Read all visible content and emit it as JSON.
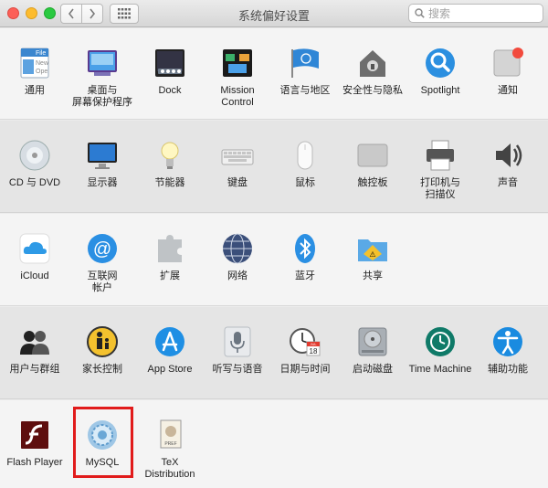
{
  "window": {
    "title": "系统偏好设置"
  },
  "search": {
    "placeholder": "搜索"
  },
  "rows": [
    [
      {
        "name": "pane-general",
        "icon": "general-icon",
        "label": "通用"
      },
      {
        "name": "pane-desktop",
        "icon": "desktop-screensaver-icon",
        "label": "桌面与\n屏幕保护程序"
      },
      {
        "name": "pane-dock",
        "icon": "dock-icon",
        "label": "Dock"
      },
      {
        "name": "pane-mission-control",
        "icon": "mission-control-icon",
        "label": "Mission\nControl"
      },
      {
        "name": "pane-language-region",
        "icon": "flag-icon",
        "label": "语言与地区"
      },
      {
        "name": "pane-security",
        "icon": "house-lock-icon",
        "label": "安全性与隐私"
      },
      {
        "name": "pane-spotlight",
        "icon": "spotlight-icon",
        "label": "Spotlight"
      },
      {
        "name": "pane-notifications",
        "icon": "notification-icon",
        "label": "通知"
      }
    ],
    [
      {
        "name": "pane-cd-dvd",
        "icon": "disc-icon",
        "label": "CD 与 DVD"
      },
      {
        "name": "pane-displays",
        "icon": "display-icon",
        "label": "显示器"
      },
      {
        "name": "pane-energy",
        "icon": "lightbulb-icon",
        "label": "节能器"
      },
      {
        "name": "pane-keyboard",
        "icon": "keyboard-icon",
        "label": "键盘"
      },
      {
        "name": "pane-mouse",
        "icon": "mouse-icon",
        "label": "鼠标"
      },
      {
        "name": "pane-trackpad",
        "icon": "trackpad-icon",
        "label": "触控板"
      },
      {
        "name": "pane-printers",
        "icon": "printer-icon",
        "label": "打印机与\n扫描仪"
      },
      {
        "name": "pane-sound",
        "icon": "speaker-icon",
        "label": "声音"
      }
    ],
    [
      {
        "name": "pane-icloud",
        "icon": "icloud-icon",
        "label": "iCloud"
      },
      {
        "name": "pane-internet-accounts",
        "icon": "at-icon",
        "label": "互联网\n帐户"
      },
      {
        "name": "pane-extensions",
        "icon": "puzzle-icon",
        "label": "扩展"
      },
      {
        "name": "pane-network",
        "icon": "globe-icon",
        "label": "网络"
      },
      {
        "name": "pane-bluetooth",
        "icon": "bluetooth-icon",
        "label": "蓝牙"
      },
      {
        "name": "pane-sharing",
        "icon": "sharing-folder-icon",
        "label": "共享"
      }
    ],
    [
      {
        "name": "pane-users-groups",
        "icon": "users-icon",
        "label": "用户与群组"
      },
      {
        "name": "pane-parental-controls",
        "icon": "parental-icon",
        "label": "家长控制"
      },
      {
        "name": "pane-app-store",
        "icon": "app-store-icon",
        "label": "App Store"
      },
      {
        "name": "pane-dictation-speech",
        "icon": "microphone-icon",
        "label": "听写与语音"
      },
      {
        "name": "pane-date-time",
        "icon": "clock-calendar-icon",
        "label": "日期与时间"
      },
      {
        "name": "pane-startup-disk",
        "icon": "hard-disk-icon",
        "label": "启动磁盘"
      },
      {
        "name": "pane-time-machine",
        "icon": "time-machine-icon",
        "label": "Time Machine"
      },
      {
        "name": "pane-accessibility",
        "icon": "accessibility-icon",
        "label": "辅助功能"
      }
    ],
    [
      {
        "name": "pane-flash-player",
        "icon": "flash-icon",
        "label": "Flash Player"
      },
      {
        "name": "pane-mysql",
        "icon": "mysql-icon",
        "label": "MySQL"
      },
      {
        "name": "pane-tex-distribution",
        "icon": "tex-icon",
        "label": "TeX\nDistribution"
      }
    ]
  ],
  "icon_text": {
    "calendar_day": "18",
    "calendar_month": "JUL",
    "general_file": "File",
    "general_new": "New",
    "general_ope": "Ope",
    "tex_pref": "PREF"
  }
}
